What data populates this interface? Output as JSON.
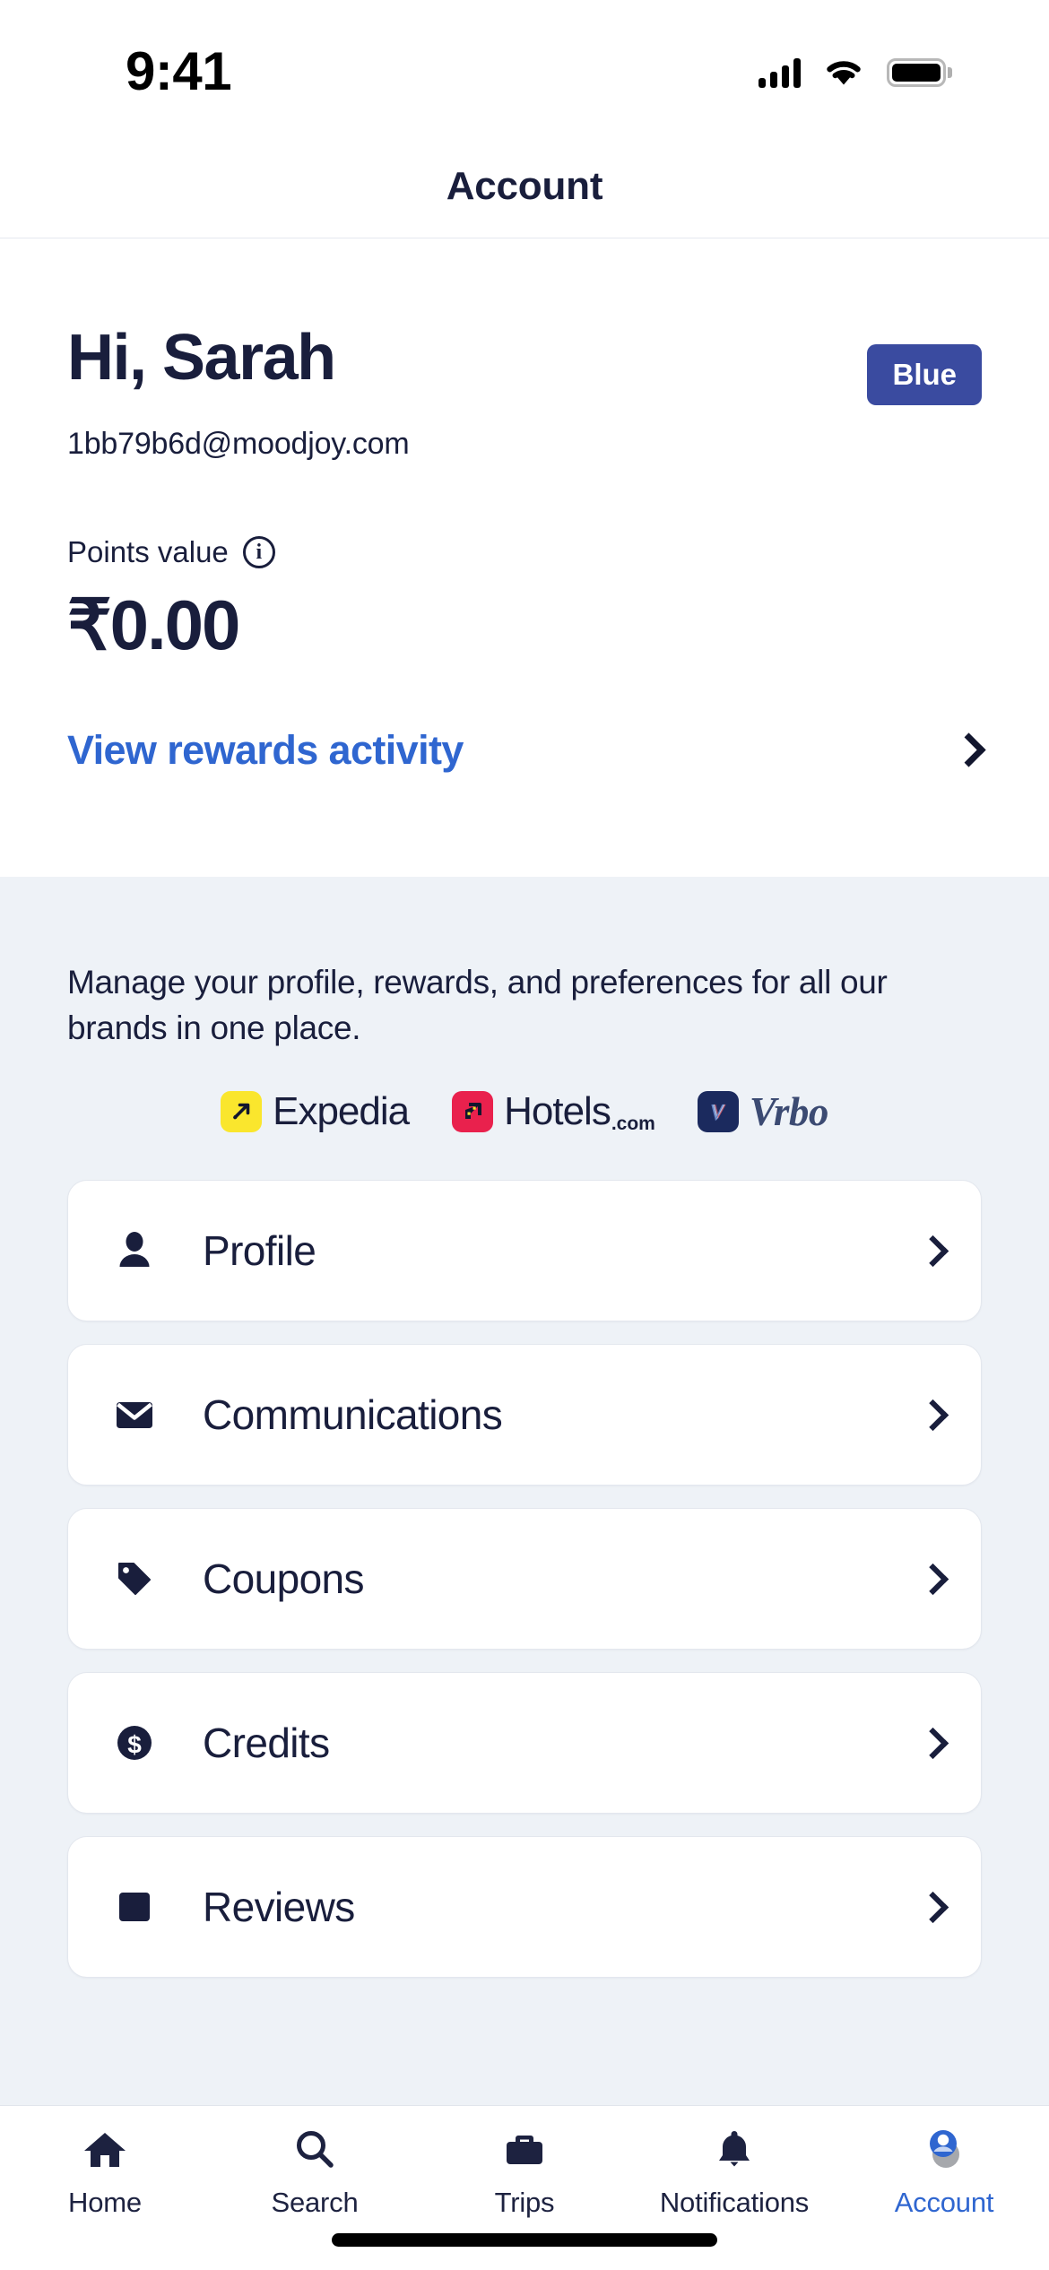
{
  "status_bar": {
    "time": "9:41",
    "signal_icon": "cellular-signal-icon",
    "wifi_icon": "wifi-icon",
    "battery_icon": "battery-full-icon"
  },
  "navbar": {
    "title": "Account"
  },
  "account_header": {
    "greeting": "Hi, Sarah",
    "tier_badge": "Blue",
    "email": "1bb79b6d@moodjoy.com",
    "points_label": "Points value",
    "points_info_icon": "info-circle-icon",
    "points_value": "₹0.00",
    "rewards_link": "View rewards activity",
    "rewards_chevron_icon": "chevron-right-icon"
  },
  "brands_section": {
    "blurb": "Manage your profile, rewards, and preferences for all our brands in one place.",
    "brands": [
      {
        "name": "Expedia",
        "suffix": "",
        "icon": "expedia-logo-icon",
        "color": "#fae62d"
      },
      {
        "name": "Hotels",
        "suffix": ".com",
        "icon": "hotels-logo-icon",
        "color": "#e9214d"
      },
      {
        "name": "Vrbo",
        "suffix": "",
        "icon": "vrbo-logo-icon",
        "color": "#1b2a5e"
      }
    ]
  },
  "menu": {
    "items": [
      {
        "label": "Profile",
        "icon": "person-icon"
      },
      {
        "label": "Communications",
        "icon": "envelope-icon"
      },
      {
        "label": "Coupons",
        "icon": "tag-icon"
      },
      {
        "label": "Credits",
        "icon": "dollar-coin-icon"
      },
      {
        "label": "Reviews",
        "icon": "review-book-icon"
      }
    ]
  },
  "tabbar": {
    "tabs": [
      {
        "label": "Home",
        "icon": "home-icon",
        "active": false
      },
      {
        "label": "Search",
        "icon": "search-icon",
        "active": false
      },
      {
        "label": "Trips",
        "icon": "briefcase-icon",
        "active": false
      },
      {
        "label": "Notifications",
        "icon": "bell-icon",
        "active": false
      },
      {
        "label": "Account",
        "icon": "account-avatar-icon",
        "active": true
      }
    ]
  },
  "colors": {
    "navy": "#191e3c",
    "link_blue": "#2f66d0",
    "badge_blue": "#3a4ba0",
    "body_bg": "#eef2f7",
    "card_bg": "#ffffff"
  }
}
